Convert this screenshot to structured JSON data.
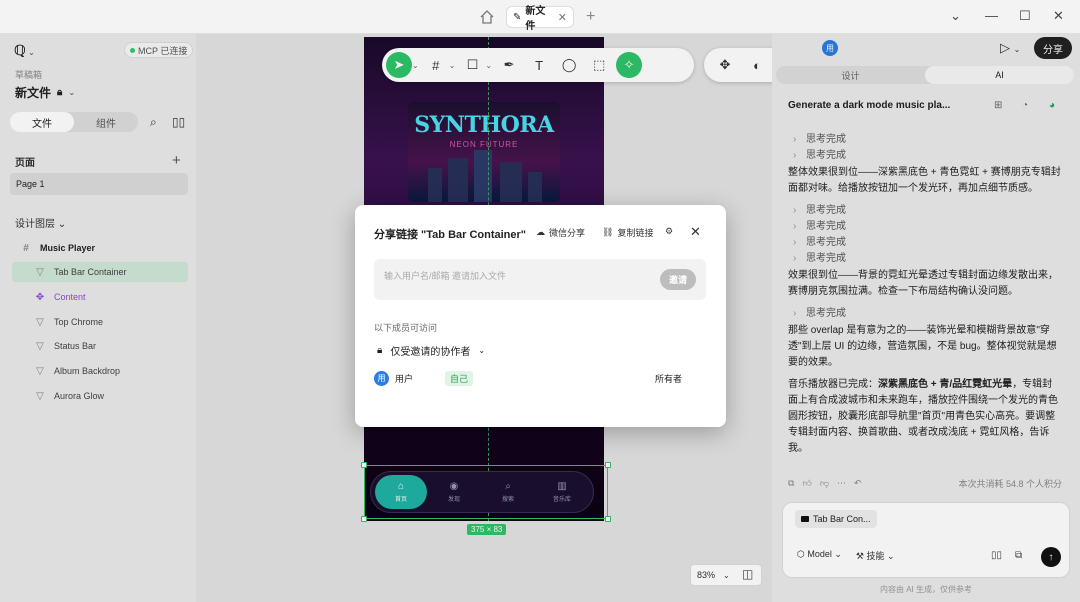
{
  "titlebar": {
    "tab_title": "新文件"
  },
  "left": {
    "mcp_status": "MCP 已连接",
    "draft_label": "草稿箱",
    "file_name": "新文件",
    "seg_file": "文件",
    "seg_component": "组件",
    "pages_title": "页面",
    "page_item": "Page 1",
    "layers_title": "设计图层",
    "layers": [
      {
        "label": "Music Player"
      },
      {
        "label": "Tab Bar Container"
      },
      {
        "label": "Content"
      },
      {
        "label": "Top Chrome"
      },
      {
        "label": "Status Bar"
      },
      {
        "label": "Album Backdrop"
      },
      {
        "label": "Aurora Glow"
      }
    ]
  },
  "canvas": {
    "album_title": "SYNTHORA",
    "album_subtitle": "NEON FUTURE",
    "tabbar_items": [
      {
        "label": "首页",
        "icon": "⌂"
      },
      {
        "label": "发现",
        "icon": "◉"
      },
      {
        "label": "搜索",
        "icon": "⌕"
      },
      {
        "label": "音乐库",
        "icon": "▥"
      }
    ],
    "dimension_badge": "375 × 83",
    "zoom": "83%"
  },
  "right": {
    "avatar_text": "用",
    "share_label": "分享",
    "seg_design": "设计",
    "seg_ai": "AI",
    "prompt": "Generate a dark mode music pla...",
    "thinking_label": "思考完成",
    "para1": "整体效果很到位——深紫黑底色 + 青色霓虹 + 赛博朋克专辑封面都对味。给播放按钮加一个发光环，再加点细节质感。",
    "para2": "效果很到位——背景的霓虹光晕透过专辑封面边缘发散出来，赛博朋克氛围拉满。检查一下布局结构确认没问题。",
    "para3": "那些 overlap 是有意为之的——装饰光晕和模糊背景故意\"穿透\"到上层 UI 的边缘，营造氛围，不是 bug。整体视觉就是想要的效果。",
    "para4_prefix": "音乐播放器已完成：",
    "para4_bold": "深紫黑底色 + 青/品红霓虹光晕",
    "para4_rest": "，专辑封面上有合成波城市和未来跑车，播放控件围绕一个发光的青色圆形按钮，胶囊形底部导航里\"首页\"用青色实心高亮。要调整专辑封面内容、换首歌曲、或者改成浅底 + 霓虹风格，告诉我。",
    "usage": "本次共消耗 54.8 个人积分",
    "chip_label": "Tab Bar Con...",
    "model_label": "Model",
    "skills_label": "技能",
    "disclaimer": "内容由 AI 生成，仅供参考"
  },
  "dialog": {
    "title": "分享链接 \"Tab Bar Container\"",
    "wechat_share": "微信分享",
    "copy_link": "复制链接",
    "invite_placeholder": "输入用户名/邮箱 邀请加入文件",
    "invite_button": "邀请",
    "members_title": "以下成员可访问",
    "access_level": "仅受邀请的协作者",
    "member_avatar": "用",
    "member_name": "用户",
    "self_badge": "自己",
    "member_role": "所有者"
  }
}
